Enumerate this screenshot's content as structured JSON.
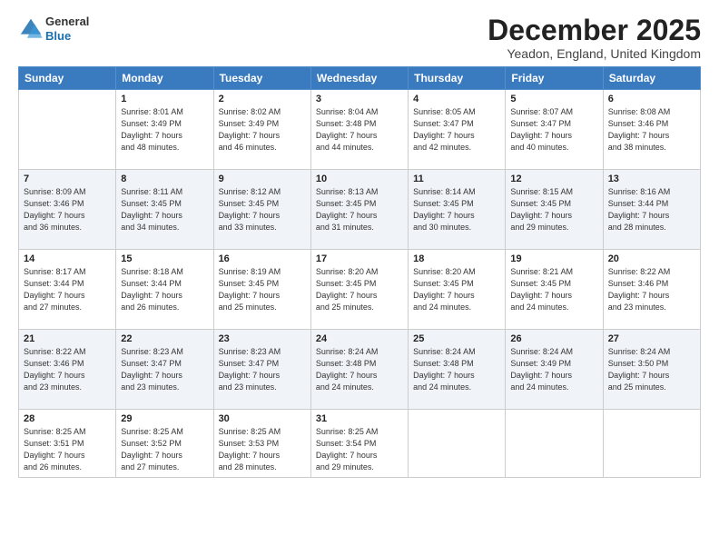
{
  "header": {
    "logo_line1": "General",
    "logo_line2": "Blue",
    "title": "December 2025",
    "location": "Yeadon, England, United Kingdom"
  },
  "days_of_week": [
    "Sunday",
    "Monday",
    "Tuesday",
    "Wednesday",
    "Thursday",
    "Friday",
    "Saturday"
  ],
  "weeks": [
    [
      {
        "day": "",
        "sunrise": "",
        "sunset": "",
        "daylight": ""
      },
      {
        "day": "1",
        "sunrise": "Sunrise: 8:01 AM",
        "sunset": "Sunset: 3:49 PM",
        "daylight": "Daylight: 7 hours and 48 minutes."
      },
      {
        "day": "2",
        "sunrise": "Sunrise: 8:02 AM",
        "sunset": "Sunset: 3:49 PM",
        "daylight": "Daylight: 7 hours and 46 minutes."
      },
      {
        "day": "3",
        "sunrise": "Sunrise: 8:04 AM",
        "sunset": "Sunset: 3:48 PM",
        "daylight": "Daylight: 7 hours and 44 minutes."
      },
      {
        "day": "4",
        "sunrise": "Sunrise: 8:05 AM",
        "sunset": "Sunset: 3:47 PM",
        "daylight": "Daylight: 7 hours and 42 minutes."
      },
      {
        "day": "5",
        "sunrise": "Sunrise: 8:07 AM",
        "sunset": "Sunset: 3:47 PM",
        "daylight": "Daylight: 7 hours and 40 minutes."
      },
      {
        "day": "6",
        "sunrise": "Sunrise: 8:08 AM",
        "sunset": "Sunset: 3:46 PM",
        "daylight": "Daylight: 7 hours and 38 minutes."
      }
    ],
    [
      {
        "day": "7",
        "sunrise": "Sunrise: 8:09 AM",
        "sunset": "Sunset: 3:46 PM",
        "daylight": "Daylight: 7 hours and 36 minutes."
      },
      {
        "day": "8",
        "sunrise": "Sunrise: 8:11 AM",
        "sunset": "Sunset: 3:45 PM",
        "daylight": "Daylight: 7 hours and 34 minutes."
      },
      {
        "day": "9",
        "sunrise": "Sunrise: 8:12 AM",
        "sunset": "Sunset: 3:45 PM",
        "daylight": "Daylight: 7 hours and 33 minutes."
      },
      {
        "day": "10",
        "sunrise": "Sunrise: 8:13 AM",
        "sunset": "Sunset: 3:45 PM",
        "daylight": "Daylight: 7 hours and 31 minutes."
      },
      {
        "day": "11",
        "sunrise": "Sunrise: 8:14 AM",
        "sunset": "Sunset: 3:45 PM",
        "daylight": "Daylight: 7 hours and 30 minutes."
      },
      {
        "day": "12",
        "sunrise": "Sunrise: 8:15 AM",
        "sunset": "Sunset: 3:45 PM",
        "daylight": "Daylight: 7 hours and 29 minutes."
      },
      {
        "day": "13",
        "sunrise": "Sunrise: 8:16 AM",
        "sunset": "Sunset: 3:44 PM",
        "daylight": "Daylight: 7 hours and 28 minutes."
      }
    ],
    [
      {
        "day": "14",
        "sunrise": "Sunrise: 8:17 AM",
        "sunset": "Sunset: 3:44 PM",
        "daylight": "Daylight: 7 hours and 27 minutes."
      },
      {
        "day": "15",
        "sunrise": "Sunrise: 8:18 AM",
        "sunset": "Sunset: 3:44 PM",
        "daylight": "Daylight: 7 hours and 26 minutes."
      },
      {
        "day": "16",
        "sunrise": "Sunrise: 8:19 AM",
        "sunset": "Sunset: 3:45 PM",
        "daylight": "Daylight: 7 hours and 25 minutes."
      },
      {
        "day": "17",
        "sunrise": "Sunrise: 8:20 AM",
        "sunset": "Sunset: 3:45 PM",
        "daylight": "Daylight: 7 hours and 25 minutes."
      },
      {
        "day": "18",
        "sunrise": "Sunrise: 8:20 AM",
        "sunset": "Sunset: 3:45 PM",
        "daylight": "Daylight: 7 hours and 24 minutes."
      },
      {
        "day": "19",
        "sunrise": "Sunrise: 8:21 AM",
        "sunset": "Sunset: 3:45 PM",
        "daylight": "Daylight: 7 hours and 24 minutes."
      },
      {
        "day": "20",
        "sunrise": "Sunrise: 8:22 AM",
        "sunset": "Sunset: 3:46 PM",
        "daylight": "Daylight: 7 hours and 23 minutes."
      }
    ],
    [
      {
        "day": "21",
        "sunrise": "Sunrise: 8:22 AM",
        "sunset": "Sunset: 3:46 PM",
        "daylight": "Daylight: 7 hours and 23 minutes."
      },
      {
        "day": "22",
        "sunrise": "Sunrise: 8:23 AM",
        "sunset": "Sunset: 3:47 PM",
        "daylight": "Daylight: 7 hours and 23 minutes."
      },
      {
        "day": "23",
        "sunrise": "Sunrise: 8:23 AM",
        "sunset": "Sunset: 3:47 PM",
        "daylight": "Daylight: 7 hours and 23 minutes."
      },
      {
        "day": "24",
        "sunrise": "Sunrise: 8:24 AM",
        "sunset": "Sunset: 3:48 PM",
        "daylight": "Daylight: 7 hours and 24 minutes."
      },
      {
        "day": "25",
        "sunrise": "Sunrise: 8:24 AM",
        "sunset": "Sunset: 3:48 PM",
        "daylight": "Daylight: 7 hours and 24 minutes."
      },
      {
        "day": "26",
        "sunrise": "Sunrise: 8:24 AM",
        "sunset": "Sunset: 3:49 PM",
        "daylight": "Daylight: 7 hours and 24 minutes."
      },
      {
        "day": "27",
        "sunrise": "Sunrise: 8:24 AM",
        "sunset": "Sunset: 3:50 PM",
        "daylight": "Daylight: 7 hours and 25 minutes."
      }
    ],
    [
      {
        "day": "28",
        "sunrise": "Sunrise: 8:25 AM",
        "sunset": "Sunset: 3:51 PM",
        "daylight": "Daylight: 7 hours and 26 minutes."
      },
      {
        "day": "29",
        "sunrise": "Sunrise: 8:25 AM",
        "sunset": "Sunset: 3:52 PM",
        "daylight": "Daylight: 7 hours and 27 minutes."
      },
      {
        "day": "30",
        "sunrise": "Sunrise: 8:25 AM",
        "sunset": "Sunset: 3:53 PM",
        "daylight": "Daylight: 7 hours and 28 minutes."
      },
      {
        "day": "31",
        "sunrise": "Sunrise: 8:25 AM",
        "sunset": "Sunset: 3:54 PM",
        "daylight": "Daylight: 7 hours and 29 minutes."
      },
      {
        "day": "",
        "sunrise": "",
        "sunset": "",
        "daylight": ""
      },
      {
        "day": "",
        "sunrise": "",
        "sunset": "",
        "daylight": ""
      },
      {
        "day": "",
        "sunrise": "",
        "sunset": "",
        "daylight": ""
      }
    ]
  ]
}
